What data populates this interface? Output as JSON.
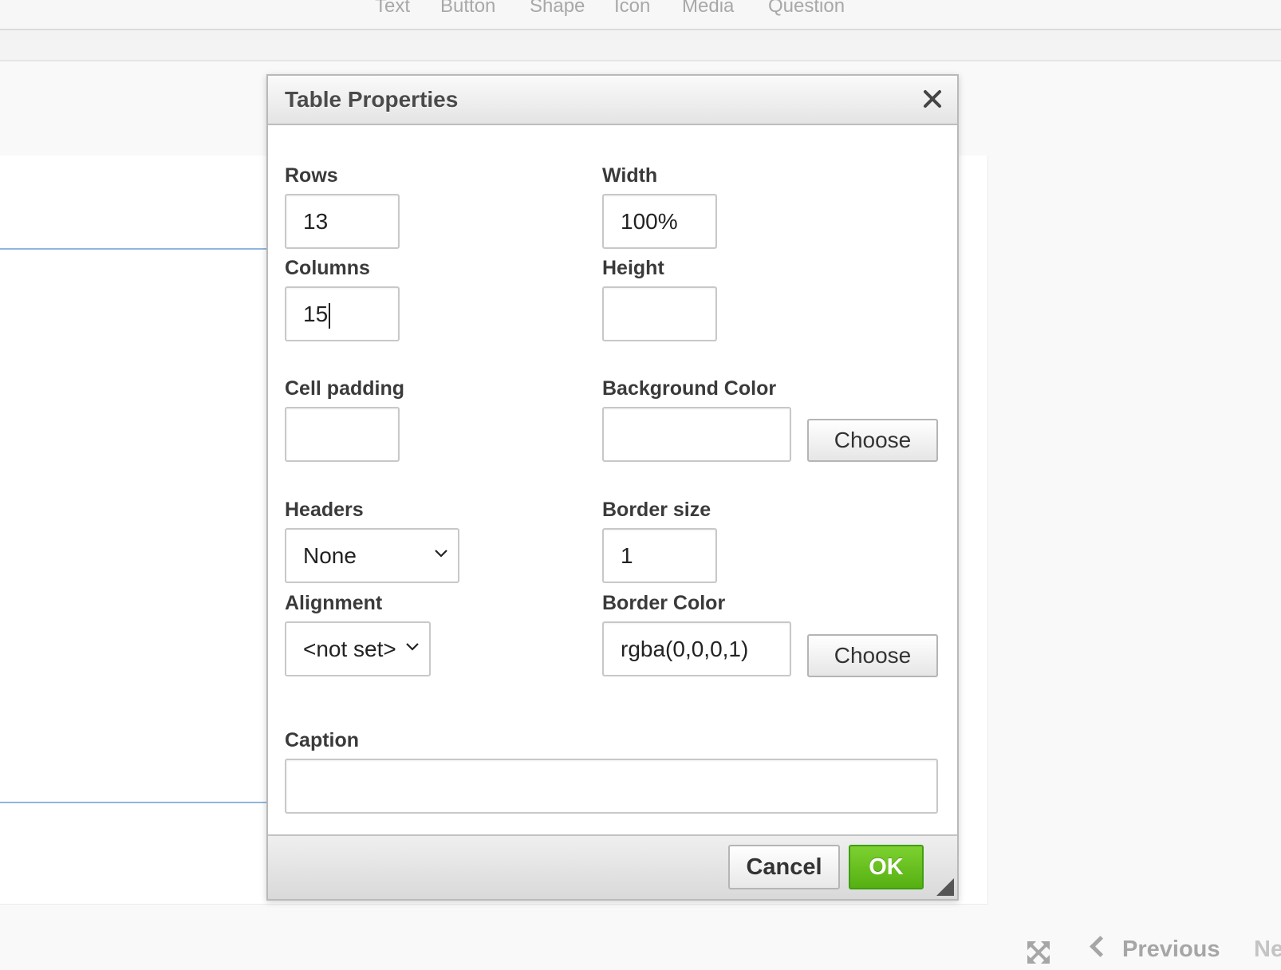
{
  "toolbar": {
    "tabs": [
      "Text",
      "Button",
      "Shape",
      "Icon",
      "Media",
      "Question"
    ]
  },
  "dialog": {
    "title": "Table Properties",
    "rows_label": "Rows",
    "rows_value": "13",
    "columns_label": "Columns",
    "columns_value": "15",
    "cell_padding_label": "Cell padding",
    "cell_padding_value": "",
    "headers_label": "Headers",
    "headers_value": "None",
    "alignment_label": "Alignment",
    "alignment_value": "<not set>",
    "width_label": "Width",
    "width_value": "100%",
    "height_label": "Height",
    "height_value": "",
    "bg_color_label": "Background Color",
    "bg_color_value": "",
    "choose_label": "Choose",
    "border_size_label": "Border size",
    "border_size_value": "1",
    "border_color_label": "Border Color",
    "border_color_value": "rgba(0,0,0,1)",
    "caption_label": "Caption",
    "caption_value": "",
    "cancel_label": "Cancel",
    "ok_label": "OK"
  },
  "nav": {
    "previous_label": "Previous",
    "next_label": "Ne"
  },
  "colors": {
    "ok_button": "#5ab614",
    "canvas_guide": "#8fb6dc",
    "nav_text": "#a6a6a6"
  }
}
